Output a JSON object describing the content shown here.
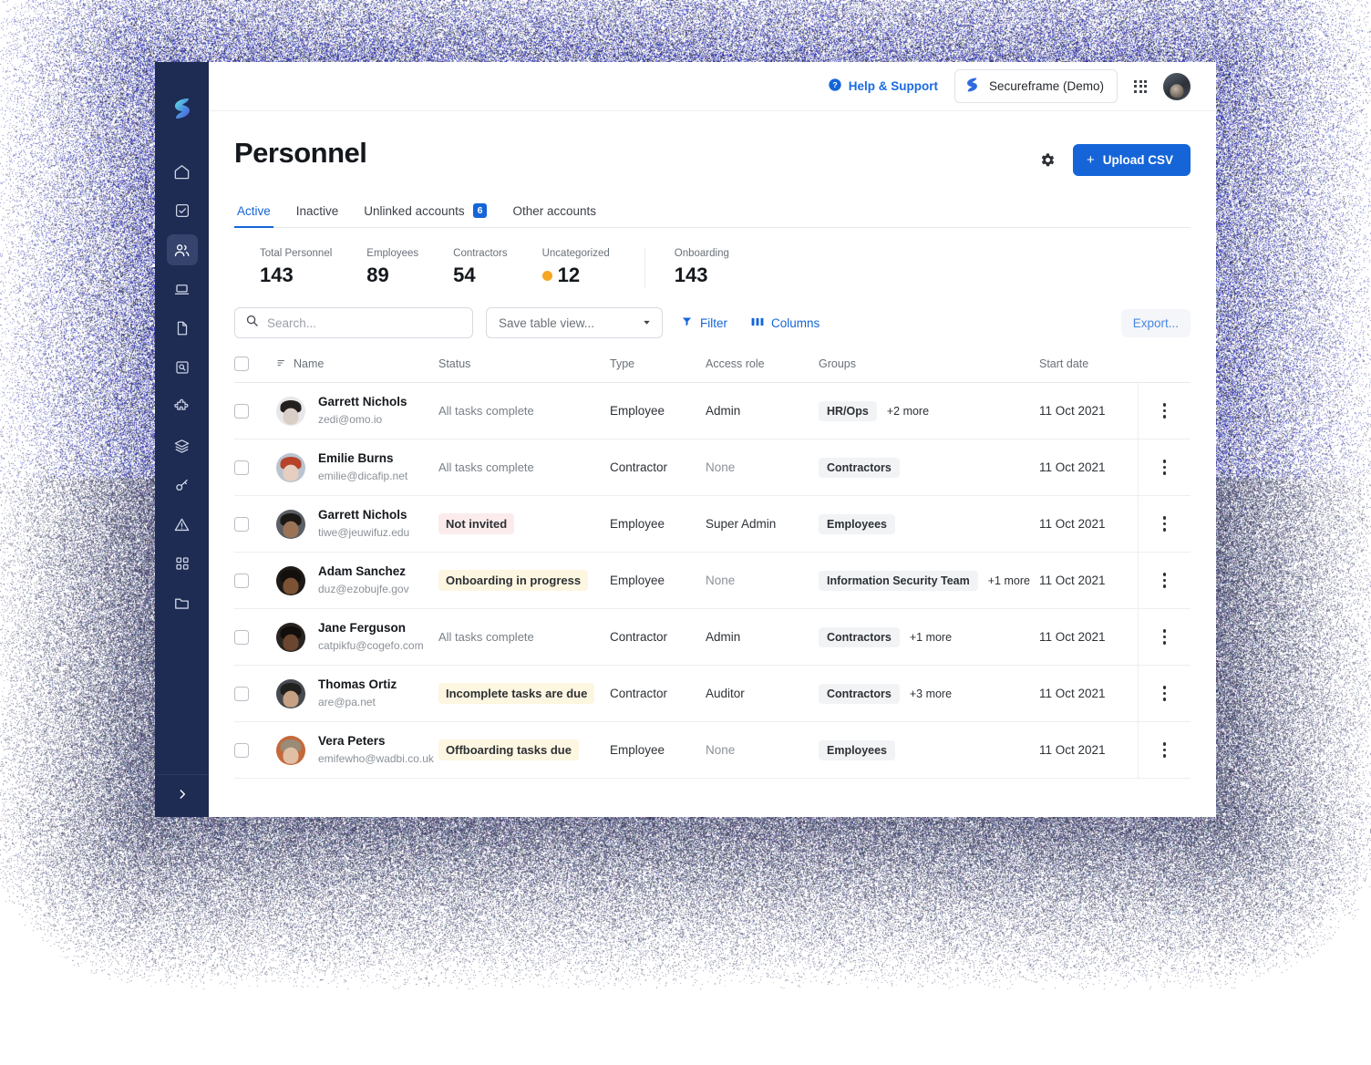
{
  "topbar": {
    "help_label": "Help & Support",
    "org_name": "Secureframe (Demo)",
    "help_icon": "question-circle-icon",
    "apps_icon": "grid-apps-icon",
    "avatar_icon": "user-avatar"
  },
  "sidebar": {
    "logo": "secureframe-logo",
    "items": [
      {
        "icon": "home-icon",
        "name": "home"
      },
      {
        "icon": "checkbox-icon",
        "name": "tasks"
      },
      {
        "icon": "people-icon",
        "name": "personnel",
        "active": true
      },
      {
        "icon": "laptop-icon",
        "name": "devices"
      },
      {
        "icon": "document-icon",
        "name": "policies"
      },
      {
        "icon": "search-doc-icon",
        "name": "audits"
      },
      {
        "icon": "puzzle-icon",
        "name": "integrations"
      },
      {
        "icon": "layers-icon",
        "name": "frameworks"
      },
      {
        "icon": "key-icon",
        "name": "access"
      },
      {
        "icon": "warning-icon",
        "name": "risks"
      },
      {
        "icon": "apps-grid-icon",
        "name": "vendors"
      },
      {
        "icon": "folder-icon",
        "name": "files"
      }
    ],
    "expand_icon": "chevron-right-icon"
  },
  "page": {
    "title": "Personnel",
    "gear_icon": "gear-icon",
    "upload_label": "Upload CSV",
    "upload_plus": "+"
  },
  "tabs": [
    {
      "label": "Active",
      "active": true
    },
    {
      "label": "Inactive",
      "active": false
    },
    {
      "label": "Unlinked accounts",
      "badge": "6",
      "active": false
    },
    {
      "label": "Other accounts",
      "active": false
    }
  ],
  "stats": [
    {
      "label": "Total Personnel",
      "value": "143",
      "warn": false,
      "divided": false
    },
    {
      "label": "Employees",
      "value": "89",
      "warn": false,
      "divided": false
    },
    {
      "label": "Contractors",
      "value": "54",
      "warn": false,
      "divided": false
    },
    {
      "label": "Uncategorized",
      "value": "12",
      "warn": true,
      "divided": false
    },
    {
      "label": "Onboarding",
      "value": "143",
      "warn": false,
      "divided": true
    }
  ],
  "toolbar": {
    "search_placeholder": "Search...",
    "search_value": "",
    "search_icon": "search-icon",
    "table_view_label": "Save table view...",
    "chevron_icon": "chevron-down-icon",
    "filter_label": "Filter",
    "filter_icon": "filter-icon",
    "columns_label": "Columns",
    "columns_icon": "columns-icon",
    "export_label": "Export..."
  },
  "table": {
    "columns": [
      "Name",
      "Status",
      "Type",
      "Access role",
      "Groups",
      "Start date"
    ],
    "sort_icon": "sort-icon",
    "rows": [
      {
        "name": "Garrett Nichols",
        "email": "zedi@omo.io",
        "status": "All tasks complete",
        "status_style": "plain",
        "type": "Employee",
        "role": "Admin",
        "role_none": false,
        "groups": [
          "HR/Ops"
        ],
        "more": "+2 more",
        "start_date": "11 Oct 2021",
        "avatar": {
          "bg": "#e8e8ea",
          "face": "#d9cfc6",
          "hair": "#23201e"
        }
      },
      {
        "name": "Emilie Burns",
        "email": "emilie@dicafip.net",
        "status": "All tasks complete",
        "status_style": "plain",
        "type": "Contractor",
        "role": "None",
        "role_none": true,
        "groups": [
          "Contractors"
        ],
        "more": "",
        "start_date": "11 Oct 2021",
        "avatar": {
          "bg": "#b9c4cf",
          "face": "#e6cfc0",
          "hair": "#b6432a"
        }
      },
      {
        "name": "Garrett Nichols",
        "email": "tiwe@jeuwifuz.edu",
        "status": "Not invited",
        "status_style": "danger",
        "type": "Employee",
        "role": "Super Admin",
        "role_none": false,
        "groups": [
          "Employees"
        ],
        "more": "",
        "start_date": "11 Oct 2021",
        "avatar": {
          "bg": "#5b5f66",
          "face": "#9b7458",
          "hair": "#1b1714"
        }
      },
      {
        "name": "Adam Sanchez",
        "email": "duz@ezobujfe.gov",
        "status": "Onboarding in progress",
        "status_style": "warn",
        "type": "Employee",
        "role": "None",
        "role_none": true,
        "groups": [
          "Information Security Team"
        ],
        "more": "+1 more",
        "start_date": "11 Oct 2021",
        "avatar": {
          "bg": "#1d1a18",
          "face": "#7b5233",
          "hair": "#120f0d"
        }
      },
      {
        "name": "Jane Ferguson",
        "email": "catpikfu@cogefo.com",
        "status": "All tasks complete",
        "status_style": "plain",
        "type": "Contractor",
        "role": "Admin",
        "role_none": false,
        "groups": [
          "Contractors"
        ],
        "more": "+1 more",
        "start_date": "11 Oct 2021",
        "avatar": {
          "bg": "#2a2420",
          "face": "#6b4630",
          "hair": "#110e0c"
        }
      },
      {
        "name": "Thomas Ortiz",
        "email": "are@pa.net",
        "status": "Incomplete tasks are due",
        "status_style": "warn",
        "type": "Contractor",
        "role": "Auditor",
        "role_none": false,
        "groups": [
          "Contractors"
        ],
        "more": "+3 more",
        "start_date": "11 Oct 2021",
        "avatar": {
          "bg": "#474a50",
          "face": "#c8a184",
          "hair": "#20201f"
        }
      },
      {
        "name": "Vera Peters",
        "email": "emifewho@wadbi.co.uk",
        "status": "Offboarding tasks due",
        "status_style": "warn",
        "type": "Employee",
        "role": "None",
        "role_none": true,
        "groups": [
          "Employees"
        ],
        "more": "",
        "start_date": "11 Oct 2021",
        "avatar": {
          "bg": "#c4693a",
          "face": "#e0bfa4",
          "hair": "#9a8a78"
        }
      }
    ]
  },
  "colors": {
    "accent": "#1565d8",
    "sidebar": "#1e2b53",
    "warn": "#f5a623",
    "badge_warn_bg": "#fdf6e0",
    "badge_danger_bg": "#fbeceb"
  }
}
